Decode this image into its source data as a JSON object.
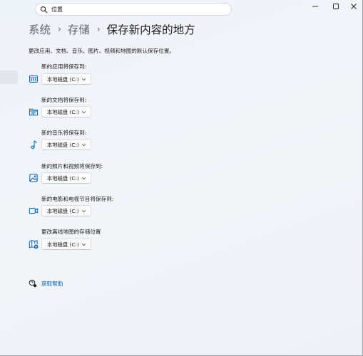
{
  "search": {
    "value": "位置"
  },
  "breadcrumb": {
    "items": [
      "系统",
      "存储",
      "保存新内容的地方"
    ],
    "separator": "›"
  },
  "description": "更改应用、文档、音乐、图片、视频和地图的默认保存位置。",
  "settings": [
    {
      "label": "新的应用将保存到:",
      "icon": "app-window-icon",
      "value": "本地磁盘 (C:)"
    },
    {
      "label": "新的文档将保存到:",
      "icon": "folder-document-icon",
      "value": "本地磁盘 (C:)"
    },
    {
      "label": "新的音乐将保存到:",
      "icon": "music-note-icon",
      "value": "本地磁盘 (C:)"
    },
    {
      "label": "新的照片和视频将保存到:",
      "icon": "photo-icon",
      "value": "本地磁盘 (C:)"
    },
    {
      "label": "新的电影和电视节目将保存到:",
      "icon": "video-camera-icon",
      "value": "本地磁盘 (C:)"
    },
    {
      "label": "更改离线地图的存储位置",
      "icon": "map-location-icon",
      "value": "本地磁盘 (C:)"
    }
  ],
  "help": {
    "label": "获取帮助"
  },
  "colors": {
    "accent": "#005fb8",
    "icon": "#0063b1",
    "text": "#1b1b1b"
  }
}
